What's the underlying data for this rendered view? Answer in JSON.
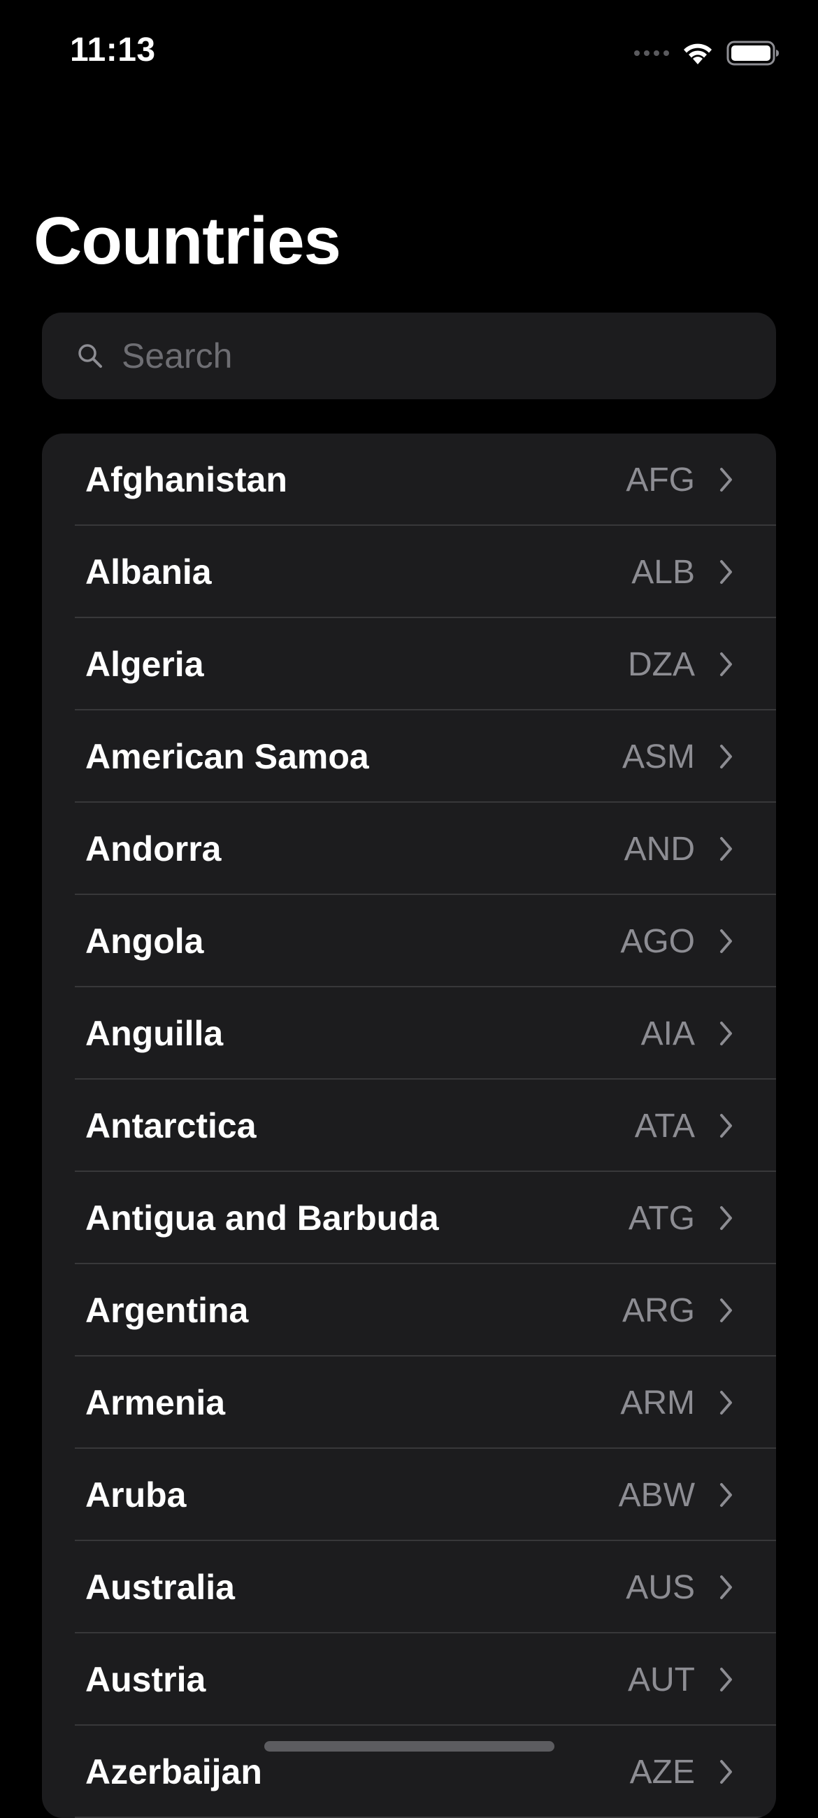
{
  "status_bar": {
    "time": "11:13"
  },
  "title": "Countries",
  "search": {
    "placeholder": "Search",
    "value": ""
  },
  "countries": [
    {
      "name": "Afghanistan",
      "code": "AFG"
    },
    {
      "name": "Albania",
      "code": "ALB"
    },
    {
      "name": "Algeria",
      "code": "DZA"
    },
    {
      "name": "American Samoa",
      "code": "ASM"
    },
    {
      "name": "Andorra",
      "code": "AND"
    },
    {
      "name": "Angola",
      "code": "AGO"
    },
    {
      "name": "Anguilla",
      "code": "AIA"
    },
    {
      "name": "Antarctica",
      "code": "ATA"
    },
    {
      "name": "Antigua and Barbuda",
      "code": "ATG"
    },
    {
      "name": "Argentina",
      "code": "ARG"
    },
    {
      "name": "Armenia",
      "code": "ARM"
    },
    {
      "name": "Aruba",
      "code": "ABW"
    },
    {
      "name": "Australia",
      "code": "AUS"
    },
    {
      "name": "Austria",
      "code": "AUT"
    },
    {
      "name": "Azerbaijan",
      "code": "AZE"
    }
  ],
  "icons": {
    "search": "search-icon",
    "chevron": "chevron-right-icon",
    "wifi": "wifi-icon",
    "battery": "battery-icon",
    "signal": "signal-icon"
  },
  "colors": {
    "background": "#000000",
    "surface": "#1c1c1e",
    "separator": "#38383a",
    "secondary_text": "#8d8d93",
    "placeholder": "#6e6e73"
  }
}
